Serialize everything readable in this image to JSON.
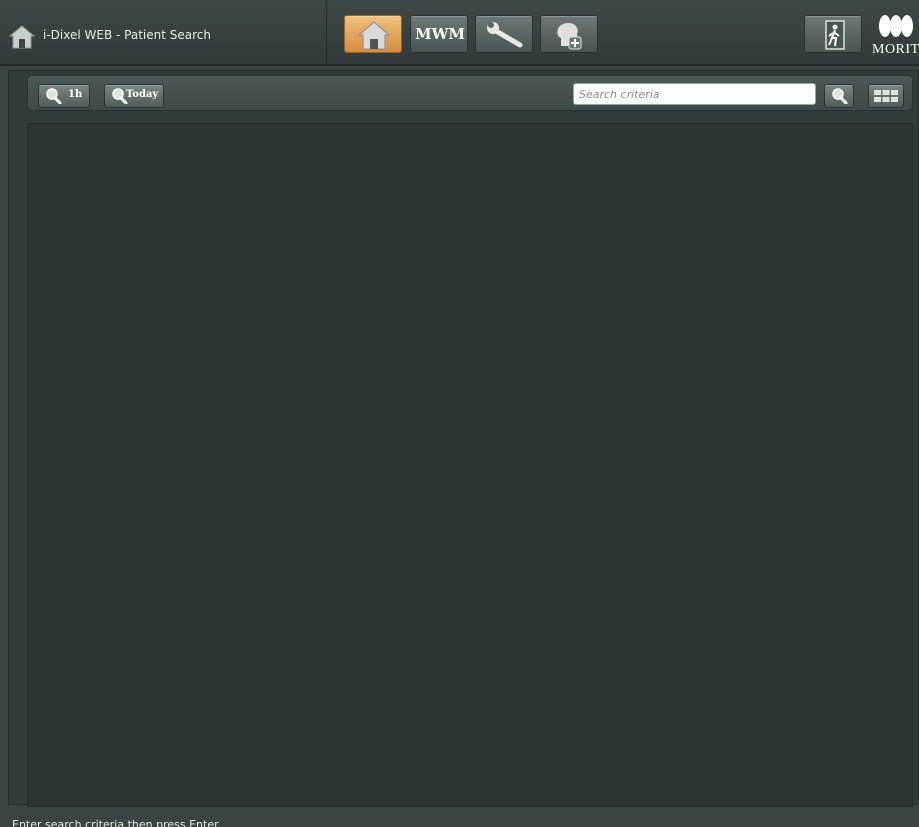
{
  "header": {
    "title": "i-Dixel WEB - Patient Search",
    "toolbar": {
      "home_icon": "home-icon",
      "mwm_label": "MWM",
      "settings_icon": "wrench-icon",
      "add_patient_icon": "add-patient-icon",
      "exit_icon": "exit-door-icon"
    },
    "brand_text": "MORITA"
  },
  "quick_search": {
    "last_hour_label": "1h",
    "today_label": "Today"
  },
  "search": {
    "placeholder": "Search criteria",
    "value": ""
  },
  "status": {
    "message": "Enter search criteria then press Enter"
  },
  "colors": {
    "background": "#3a4443",
    "active_button": "#e8a85a",
    "content": "#2d3635"
  }
}
